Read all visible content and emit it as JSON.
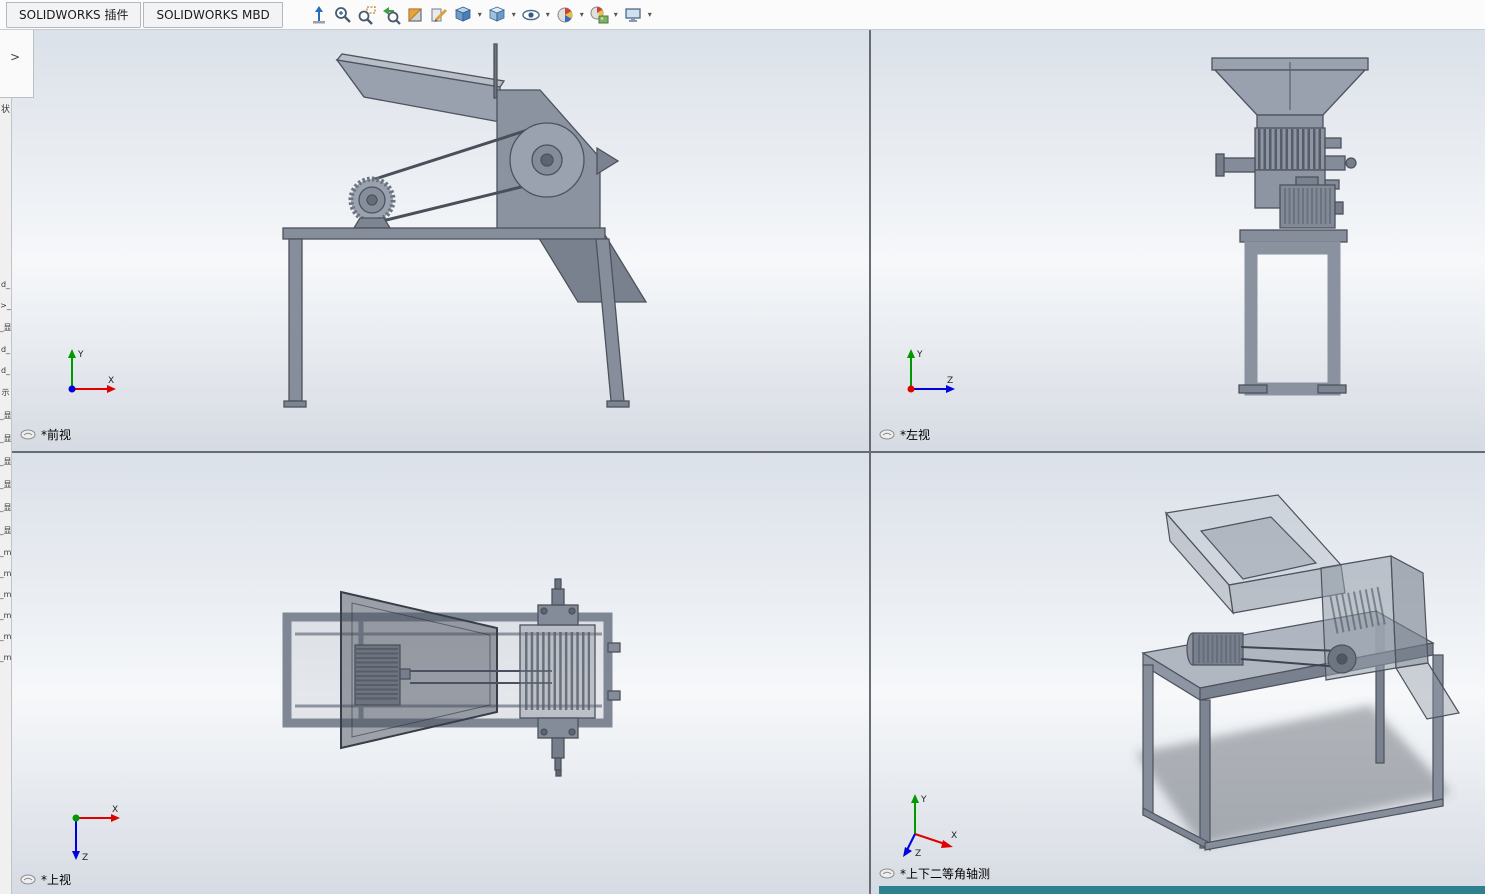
{
  "app": {
    "tabs": [
      {
        "label": "SOLIDWORKS 插件"
      },
      {
        "label": "SOLIDWORKS MBD"
      }
    ],
    "toolbar": {
      "icons": [
        {
          "name": "pan-view",
          "dropdown": false
        },
        {
          "name": "zoom-to-fit",
          "dropdown": false
        },
        {
          "name": "zoom-to-area",
          "dropdown": false
        },
        {
          "name": "previous-view",
          "dropdown": false
        },
        {
          "name": "section-view",
          "dropdown": false
        },
        {
          "name": "dynamic-annotation",
          "dropdown": false
        },
        {
          "name": "view-orientation",
          "dropdown": true
        },
        {
          "name": "display-style",
          "dropdown": true
        },
        {
          "name": "hide-show-items",
          "dropdown": true
        },
        {
          "name": "edit-appearance",
          "dropdown": true
        },
        {
          "name": "apply-scene",
          "dropdown": true
        },
        {
          "name": "view-settings",
          "dropdown": true
        }
      ],
      "dropdown_glyph": "▾"
    }
  },
  "sidebar": {
    "expand_arrow": ">",
    "top_fragment": "状",
    "fragments": [
      "d_",
      ">_",
      "_显",
      "d_",
      "d_",
      "示",
      "_显",
      "_显",
      "_显",
      "_显",
      "_显",
      "_显",
      "_m",
      "_m",
      "_m",
      "_m",
      "_m",
      "_m"
    ]
  },
  "viewports": [
    {
      "id": "front",
      "label": "*前视",
      "triad": {
        "axis_up": "Y",
        "axis_right": "X"
      }
    },
    {
      "id": "left",
      "label": "*左视",
      "triad": {
        "axis_up": "Y",
        "axis_right": "Z"
      }
    },
    {
      "id": "top",
      "label": "*上视",
      "triad": {
        "axis_right": "X",
        "axis_down": "Z"
      }
    },
    {
      "id": "isometric",
      "label": "*上下二等角轴测",
      "triad": {
        "axis_up": "Y",
        "axis_right": "X",
        "axis_down": "Z"
      }
    }
  ],
  "colors": {
    "viewport_gradient_top": "#dbe1e9",
    "viewport_gradient_mid": "#f3f5f8",
    "viewport_gradient_bottom": "#d6dbe3",
    "model_gray": "#8f97a4",
    "axis_x": "#e00000",
    "axis_y": "#009a00",
    "axis_z": "#0000dd",
    "taskbar_teal": "#2e8290"
  }
}
